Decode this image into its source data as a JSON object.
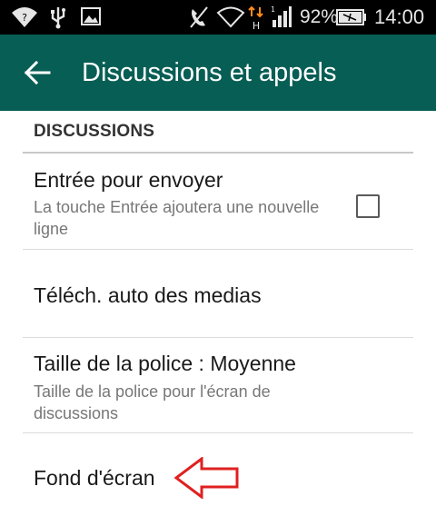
{
  "status_bar": {
    "battery_percent": "92%",
    "time": "14:00",
    "icons": [
      "wifi-question-icon",
      "usb-icon",
      "image-icon",
      "mute-icon",
      "wifi-icon",
      "data-arrows-icon",
      "signal-icon",
      "battery-icon"
    ]
  },
  "app_bar": {
    "title": "Discussions et appels",
    "background": "#075e54"
  },
  "section": {
    "header": "DISCUSSIONS"
  },
  "prefs": [
    {
      "title": "Entrée pour envoyer",
      "summary": "La touche Entrée ajoutera une nouvelle ligne",
      "checked": false
    },
    {
      "title": "Téléch. auto des medias"
    },
    {
      "title": "Taille de la police : Moyenne",
      "summary": "Taille de la police pour l'écran de discussions"
    },
    {
      "title": "Fond d'écran"
    }
  ],
  "annotation": {
    "arrow_color": "#e02020"
  }
}
